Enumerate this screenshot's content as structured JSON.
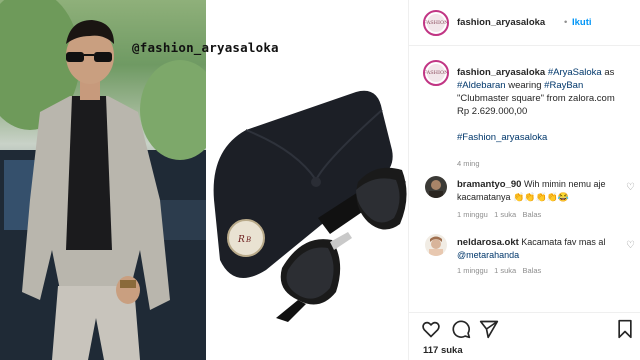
{
  "photo": {
    "watermark_handle": "@fashion_aryasaloka"
  },
  "header": {
    "username": "fashion_aryasaloka",
    "separator": "•",
    "follow_label": "Ikuti",
    "avatar_text": "FASHION"
  },
  "caption": {
    "username": "fashion_aryasaloka",
    "hashtag_name": "#AryaSaloka",
    "text_as": "as",
    "hashtag_role": "#Aldebaran",
    "text_wearing": "wearing",
    "hashtag_brand": "#RayBan",
    "text_product": "\"Clubmaster square\" from zalora.com",
    "price": "Rp 2.629.000,00",
    "hashtag_account": "#Fashion_aryasaloka",
    "time": "4 ming"
  },
  "comments": [
    {
      "username": "bramantyo_90",
      "text": "Wih mimin nemu aje kacamatanya",
      "emojis": "👏👏👏👏😂",
      "time": "1 minggu",
      "likes": "1 suka",
      "reply_label": "Balas"
    },
    {
      "username": "neldarosa.okt",
      "text_before": "Kacamata fav mas al",
      "mention": "@metarahanda",
      "time": "1 minggu",
      "likes": "1 suka",
      "reply_label": "Balas"
    }
  ],
  "footer": {
    "likes": "117 suka"
  },
  "icons": {
    "heart": "heart-icon",
    "comment": "comment-icon",
    "share": "share-icon",
    "bookmark": "bookmark-icon",
    "more": "more-options-icon"
  },
  "colors": {
    "link": "#00376b",
    "follow": "#0095f6",
    "muted": "#8e8e8e",
    "story_ring": "#c13584"
  }
}
